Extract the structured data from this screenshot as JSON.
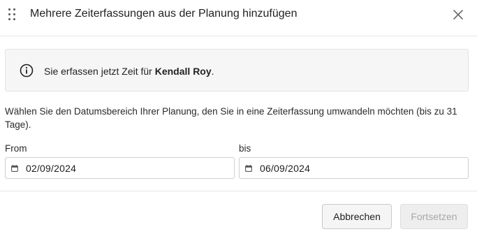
{
  "dialog": {
    "title": "Mehrere Zeiterfassungen aus der Planung hinzufügen",
    "drag_icon": "drag-handle-icon",
    "close_icon": "close-icon"
  },
  "info": {
    "icon": "info-icon",
    "prefix": "Sie erfassen jetzt Zeit für ",
    "name": "Kendall Roy",
    "suffix": "."
  },
  "description": "Wählen Sie den Datumsbereich Ihrer Planung, den Sie in eine Zeiterfassung umwandeln möchten (bis zu 31 Tage).",
  "from": {
    "label": "From",
    "value": "02/09/2024",
    "icon": "calendar-icon"
  },
  "to": {
    "label": "bis",
    "value": "06/09/2024",
    "icon": "calendar-icon"
  },
  "buttons": {
    "cancel": "Abbrechen",
    "continue": "Fortsetzen"
  },
  "colors": {
    "info_background": "#f6f6f6",
    "disabled_text": "#a8a8a8",
    "border": "#cfcfcf"
  }
}
